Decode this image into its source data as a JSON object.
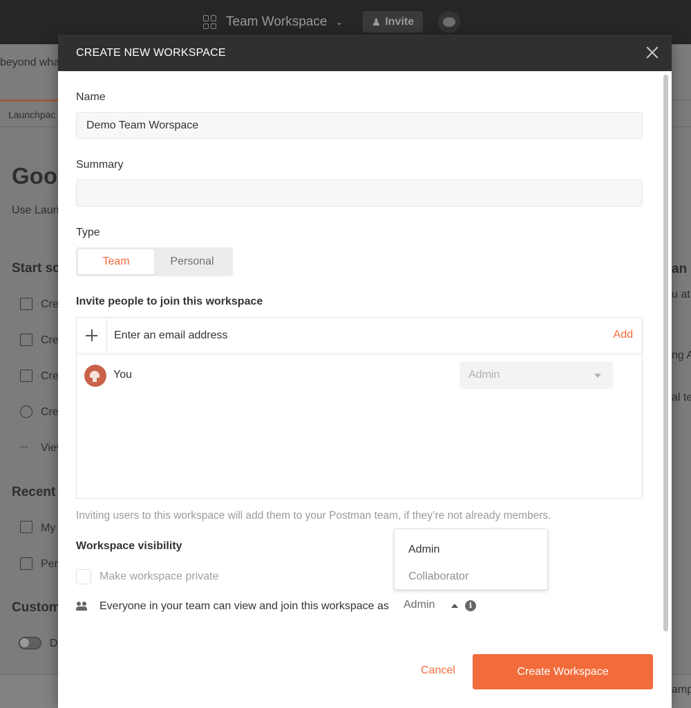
{
  "topbar": {
    "workspace_name": "Team Workspace",
    "invite_label": "Invite"
  },
  "background": {
    "banner_fragment": "beyond wha",
    "tab_fragment": "Launchpac",
    "greeting_fragment": "Goo",
    "subtitle_fragment": "Use Laun",
    "start_heading_fragment": "Start sc",
    "start_items": [
      "Cre",
      "Cre",
      "Cre",
      "Cre",
      "Viev"
    ],
    "recent_heading_fragment": "Recent",
    "recent_items": [
      "My",
      "Per"
    ],
    "custom_heading_fragment": "Custom",
    "toggle_label_fragment": "D",
    "right_fragments": [
      "an",
      "u at",
      "ng Al",
      "al te"
    ],
    "bottom_right_fragment": "amp"
  },
  "modal": {
    "title": "CREATE NEW WORKSPACE",
    "name_label": "Name",
    "name_value": "Demo Team Worspace",
    "summary_label": "Summary",
    "summary_value": "",
    "type_label": "Type",
    "type_options": [
      "Team",
      "Personal"
    ],
    "type_selected": "Team",
    "invite_heading": "Invite people to join this workspace",
    "email_placeholder": "Enter an email address",
    "add_label": "Add",
    "members": [
      {
        "name": "You",
        "role": "Admin"
      }
    ],
    "helper_text": "Inviting users to this workspace will add them to your Postman team, if they’re not already members.",
    "visibility_heading": "Workspace visibility",
    "private_label": "Make workspace private",
    "everyone_text": "Everyone in your team can view and join this workspace as",
    "everyone_role": "Admin",
    "role_options": [
      "Admin",
      "Collaborator"
    ],
    "cancel_label": "Cancel",
    "create_label": "Create Workspace"
  },
  "colors": {
    "accent": "#f26b3a",
    "header": "#303030",
    "topbar": "#262626"
  }
}
